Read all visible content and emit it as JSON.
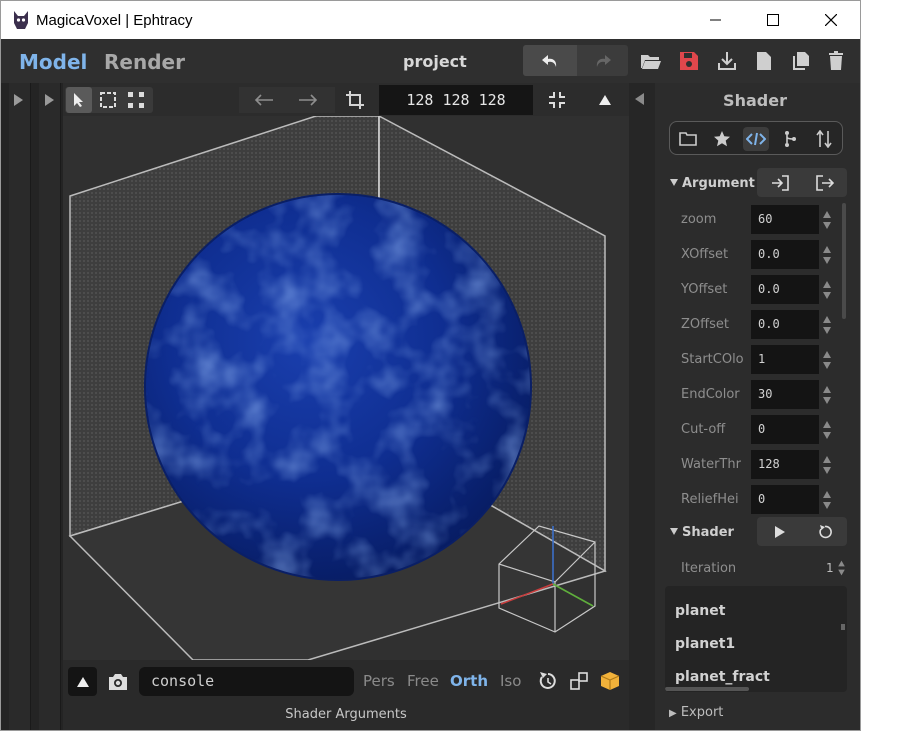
{
  "window": {
    "title": "MagicaVoxel | Ephtracy",
    "controls": [
      "minimize-icon",
      "maximize-icon",
      "close-icon"
    ]
  },
  "topbar": {
    "tabs": [
      {
        "label": "Model",
        "active": true
      },
      {
        "label": "Render",
        "active": false
      }
    ],
    "project_name": "project",
    "actions": [
      "undo-icon",
      "redo-icon",
      "open-folder-icon",
      "save-icon",
      "export-icon",
      "new-file-icon",
      "copy-icon",
      "delete-icon"
    ]
  },
  "viewport_toolbar": {
    "dimensions": "128  128  128",
    "tools": [
      "select-icon",
      "marquee-icon",
      "region-icon",
      "arrow-left-icon",
      "arrow-right-icon",
      "crop-icon",
      "collapse-icon",
      "triangle-up-icon"
    ]
  },
  "bottombar": {
    "console_placeholder": "console",
    "view_modes": [
      {
        "label": "Pers",
        "active": false
      },
      {
        "label": "Free",
        "active": false
      },
      {
        "label": "Orth",
        "active": true
      },
      {
        "label": "Iso",
        "active": false
      }
    ],
    "status": "Shader Arguments"
  },
  "shader_panel": {
    "title": "Shader",
    "tabs": [
      "folder-icon",
      "star-icon",
      "code-icon",
      "branch-icon",
      "sort-icon"
    ],
    "argument_section": "Argument",
    "arguments": [
      {
        "label": "zoom",
        "value": "60"
      },
      {
        "label": "XOffset",
        "value": "0.0"
      },
      {
        "label": "YOffset",
        "value": "0.0"
      },
      {
        "label": "ZOffset",
        "value": "0.0"
      },
      {
        "label": "StartCOlo",
        "value": "1"
      },
      {
        "label": "EndColor",
        "value": "30"
      },
      {
        "label": "Cut-off",
        "value": "0"
      },
      {
        "label": "WaterThr",
        "value": "128"
      },
      {
        "label": "ReliefHei",
        "value": "0"
      }
    ],
    "shader_section": "Shader",
    "iteration_label": "Iteration",
    "iteration_value": "1",
    "shader_list": [
      "planet",
      "planet1",
      "planet_fract"
    ],
    "export_section": "Export"
  },
  "colors": {
    "accent": "#7fb4ea",
    "save_red": "#e0474c",
    "planet": "#0b2a8a",
    "iso_cube": "#f2b23a"
  }
}
